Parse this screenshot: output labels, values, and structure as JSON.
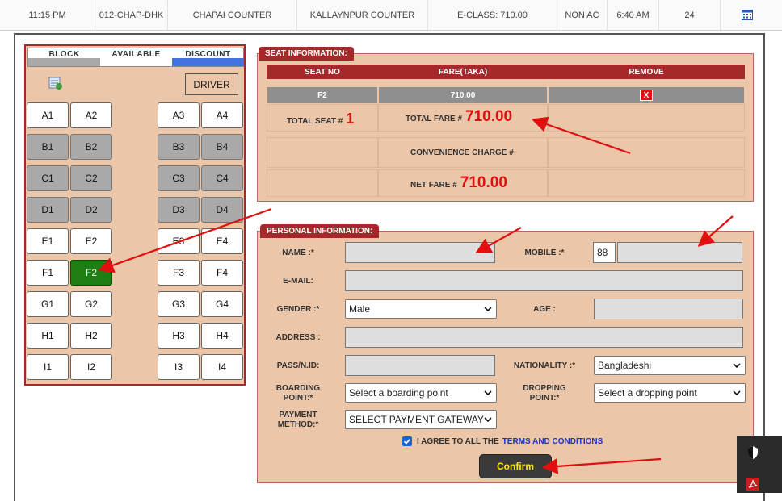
{
  "trip": {
    "departure": "11:15 PM",
    "code": "012-CHAP-DHK",
    "from_counter": "CHAPAI COUNTER",
    "to_counter": "KALLAYNPUR COUNTER",
    "class_fare": "E-CLASS: 710.00",
    "ac_type": "NON AC",
    "arrival": "6:40 AM",
    "seats_available": "24",
    "calendar_icon": "calendar-icon"
  },
  "legend": {
    "block": "BLOCK",
    "available": "AVAILABLE",
    "discount": "DISCOUNT",
    "colors": {
      "block": "#a9a9a9",
      "available": "#ffffff",
      "discount": "#4472e0"
    }
  },
  "driver_label": "DRIVER",
  "seats": [
    [
      "A1",
      "A2",
      "A3",
      "A4"
    ],
    [
      "B1",
      "B2",
      "B3",
      "B4"
    ],
    [
      "C1",
      "C2",
      "C3",
      "C4"
    ],
    [
      "D1",
      "D2",
      "D3",
      "D4"
    ],
    [
      "E1",
      "E2",
      "E3",
      "E4"
    ],
    [
      "F1",
      "F2",
      "F3",
      "F4"
    ],
    [
      "G1",
      "G2",
      "G3",
      "G4"
    ],
    [
      "H1",
      "H2",
      "H3",
      "H4"
    ],
    [
      "I1",
      "I2",
      "I3",
      "I4"
    ]
  ],
  "blocked_rows": [
    "B",
    "C",
    "D"
  ],
  "selected_seat": "F2",
  "seat_info": {
    "title": "SEAT INFORMATION:",
    "col_seat": "SEAT NO",
    "col_fare": "FARE(TAKA)",
    "col_remove": "REMOVE",
    "row_seat": "F2",
    "row_fare": "710.00",
    "remove_glyph": "X",
    "total_seat_label": "TOTAL SEAT #",
    "total_seat_value": "1",
    "total_fare_label": "TOTAL FARE #",
    "total_fare_value": "710.00",
    "convenience_label": "CONVENIENCE CHARGE #",
    "net_fare_label": "NET FARE #",
    "net_fare_value": "710.00"
  },
  "personal": {
    "title": "PERSONAL INFORMATION:",
    "name_label": "NAME :*",
    "mobile_label": "MOBILE :*",
    "mobile_prefix": "88",
    "email_label": "E-MAIL:",
    "gender_label": "GENDER :*",
    "gender_value": "Male",
    "age_label": "AGE :",
    "address_label": "ADDRESS :",
    "passport_label": "PASS/N.ID:",
    "nationality_label": "NATIONALITY :*",
    "nationality_value": "Bangladeshi",
    "boarding_label_1": "BOARDING",
    "boarding_label_2": "POINT:*",
    "boarding_value": "Select a boarding point",
    "dropping_label_1": "DROPPING",
    "dropping_label_2": "POINT:*",
    "dropping_value": "Select a dropping point",
    "payment_label_1": "PAYMENT",
    "payment_label_2": "METHOD:*",
    "payment_value": "SELECT PAYMENT GATEWAY",
    "agree_text": "I AGREE TO ALL THE",
    "terms_text": "TERMS AND CONDITIONS",
    "confirm_label": "Confirm"
  },
  "colors": {
    "panel": "#ebc6a9",
    "accent": "#a5292a",
    "selected": "#1e7e14",
    "fare": "#e01010",
    "confirm_text": "#ffe600"
  }
}
